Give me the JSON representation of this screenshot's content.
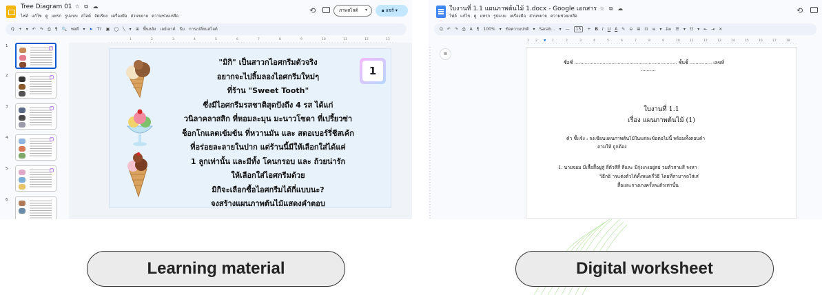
{
  "slides_window": {
    "title": "Tree Diagram 01",
    "title_marks": "☆ ⧉ ☁",
    "menu": [
      "ไฟล์",
      "แก้ไข",
      "ดู",
      "แทรก",
      "รูปแบบ",
      "สไลด์",
      "จัดเรียง",
      "เครื่องมือ",
      "ส่วนขยาย",
      "ความช่วยเหลือ"
    ],
    "slideshow_label": "ภาพสไลด์",
    "share_label": "แชร์",
    "toolbar": [
      "Q",
      "+",
      "▾",
      "↶",
      "↷",
      "⎙",
      "¶",
      "🔍",
      "พอดี",
      "▾",
      "➤",
      "Tт",
      "▣",
      "◯",
      "╲",
      "▾",
      "⊞",
      "พื้นหลัง",
      "เลย์เอาต์",
      "ธีม",
      "การเปลี่ยนสไลด์"
    ],
    "ruler_ticks": [
      "1",
      "2",
      "3",
      "4",
      "5",
      "6",
      "7",
      "8",
      "9",
      "10",
      "11",
      "12",
      "13"
    ],
    "thumb_numbers": [
      "1",
      "2",
      "3",
      "4",
      "5",
      "6"
    ],
    "slide_lines": [
      "\"มิกิ\" เป็นสาวกไอศกรีมตัวจริง",
      "อยากจะไปลิ้มลองไอศกรีมใหม่ๆ",
      "ที่ร้าน \"Sweet Tooth\"",
      "ซึ่งมีไอศกรีมรสชาติสุดปังถึง 4 รส ได้แก่",
      "วนิลาคลาสสิก ที่หอมละมุน มะนาวโซดา ที่เปรี้ยวซ่า",
      "ช็อกโกแลตเข้มข้น ที่หวานมัน และ สตอเบอร์รี่ชีสเค้ก",
      "ที่อร่อยละลายในปาก แต่ร้านนี้มีให้เลือกใส่ได้แค่",
      "1 ลูกเท่านั้น และมีทั้ง โคนกรอบ และ ถ้วยน่ารัก",
      "ให้เลือกใส่ไอศกรีมด้วย",
      "มิกิจะเลือกซื้อไอศกรีมได้กี่แบบนะ?",
      "จงสร้างแผนภาพต้นไม้แสดงคำตอบ"
    ],
    "badge": "1"
  },
  "docs_window": {
    "title": "ใบงานที่ 1.1 แผนภาพต้นไม้ 1.docx - Google เอกสาร",
    "title_marks": "☆ ⧉ ☁",
    "menu": [
      "ไฟล์",
      "แก้ไข",
      "ดู",
      "แทรก",
      "รูปแบบ",
      "เครื่องมือ",
      "ส่วนขยาย",
      "ความช่วยเหลือ"
    ],
    "toolbar": [
      "Q",
      "↶",
      "↷",
      "⎙",
      "A",
      "¶",
      "100%",
      "▾",
      "ข้อความปกติ",
      "▾",
      "Sarab...",
      "▾",
      "—",
      "15",
      "+",
      "B",
      "I",
      "U",
      "A",
      "✎",
      "⊖",
      "⊞",
      "⊡",
      "≡",
      "▾",
      "‡≡",
      "☰",
      "▾",
      "☷",
      "▾",
      "⇤",
      "⇥",
      "✕"
    ],
    "ruler_ticks": [
      "1",
      "2",
      "1",
      "2",
      "3",
      "4",
      "5",
      "6",
      "7",
      "8",
      "9",
      "10",
      "11",
      "12",
      "13",
      "14",
      "15",
      "16",
      "17",
      "18"
    ],
    "doc": {
      "name_line": "ชื่อชี่ ..................................................................... ชั้นชั้ ............... เลขที่",
      "name_cont": "..........",
      "heading1": "ใบงานที่ 1.1",
      "heading2": "เรื่อง แผนภาพต้นไม้ (1)",
      "instr1": "คำ ชี้แจ้ง : จงเขียนแผนภาพต้นไม้ในแต่ละข้อต่อไปนี้ พร้อมทั้งตอบคำ",
      "instr2": "ถามให้ ถูกต้อง",
      "q1a": "1. นายจอม มีเสื้อสื้อยู่สู่ สี่ตัวสีสี่ สีและ มีกุ่งเกงอยู่สย่ วมตัวสามสี จงหา",
      "q1b": "วิธีกธิ ารแต่งตัวได้ทั้งหมดกี่วิธี โดยที่สามารถใส่เส่",
      "q1c": "สื้อและกางเกงครั้งละตัวเท่านั้น"
    }
  },
  "labels": {
    "left": "Learning material",
    "right": "Digital worksheet"
  },
  "colors": {
    "slides_brand": "#f4b400",
    "docs_brand": "#4285f4",
    "share_button": "#c2e7ff",
    "selected_thumb": "#0b57d0",
    "pill_bg": "#ebebeb"
  },
  "icons": {
    "history": "history-icon",
    "comment": "comment-icon",
    "lock": "lock-icon"
  }
}
